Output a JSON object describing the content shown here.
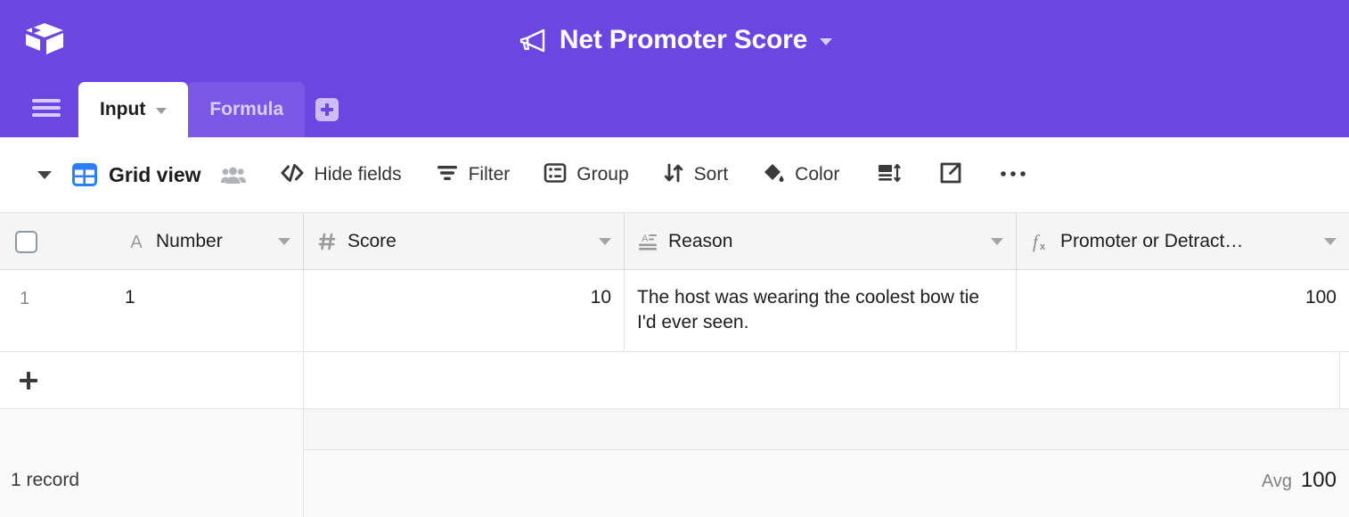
{
  "header": {
    "logo_icon": "airtable-cube-logo",
    "title": "Net Promoter Score",
    "title_icon": "megaphone-icon",
    "title_caret_icon": "chevron-down-icon",
    "menu_icon": "hamburger-menu-icon",
    "brand_color": "#6c46e0",
    "tabs": [
      {
        "label": "Input",
        "active": true,
        "caret_icon": "chevron-down-icon"
      },
      {
        "label": "Formula",
        "active": false
      }
    ],
    "add_tab_icon": "plus-square-icon"
  },
  "toolbar": {
    "collapse_caret_icon": "chevron-down-icon",
    "view_icon": "grid-view-icon",
    "view_name": "Grid view",
    "view_icon_color": "#2d7ff9",
    "collaborators_icon": "people-icon",
    "items": [
      {
        "label": "Hide fields",
        "icon": "hide-fields-icon"
      },
      {
        "label": "Filter",
        "icon": "filter-icon"
      },
      {
        "label": "Group",
        "icon": "group-icon"
      },
      {
        "label": "Sort",
        "icon": "sort-icon"
      },
      {
        "label": "Color",
        "icon": "color-paint-icon"
      }
    ],
    "icon_only_items": [
      {
        "icon": "row-height-icon"
      },
      {
        "icon": "share-export-icon"
      },
      {
        "icon": "more-options-icon"
      }
    ]
  },
  "grid": {
    "select_all_checkbox": "select-all-checkbox",
    "columns": [
      {
        "name": "Number",
        "type_icon": "single-line-text-icon",
        "align": "left"
      },
      {
        "name": "Score",
        "type_icon": "number-hash-icon",
        "align": "right"
      },
      {
        "name": "Reason",
        "type_icon": "long-text-icon",
        "align": "left"
      },
      {
        "name": "Promoter or Detract…",
        "type_icon": "formula-icon",
        "align": "right"
      }
    ],
    "rows": [
      {
        "row_number": "1",
        "cells": [
          "1",
          "10",
          "The host was wearing the coolest bow tie I'd ever seen.",
          "100"
        ]
      }
    ],
    "add_row_icon": "plus-icon",
    "footer": {
      "record_count": "1 record",
      "summary_label": "Avg",
      "summary_value": "100"
    }
  }
}
